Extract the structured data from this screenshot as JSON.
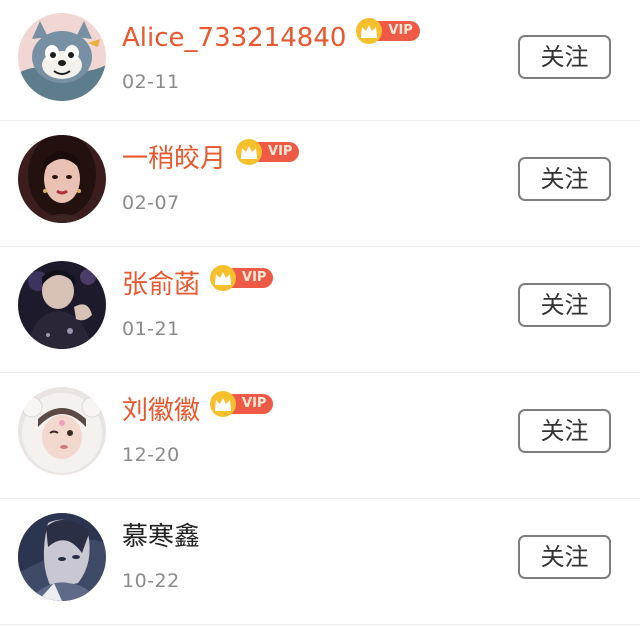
{
  "follow_list": {
    "items": [
      {
        "name": "Alice_733214840",
        "vip": true,
        "vip_label": "VIP",
        "date": "02-11",
        "follow_label": "关注",
        "avatar_icon": "cartoon-cat-avatar-icon"
      },
      {
        "name": "一稍皎月",
        "vip": true,
        "vip_label": "VIP",
        "date": "02-07",
        "follow_label": "关注",
        "avatar_icon": "woman-portrait-avatar-icon"
      },
      {
        "name": "张俞菡",
        "vip": true,
        "vip_label": "VIP",
        "date": "01-21",
        "follow_label": "关注",
        "avatar_icon": "man-stage-avatar-icon"
      },
      {
        "name": "刘徽徽",
        "vip": true,
        "vip_label": "VIP",
        "date": "12-20",
        "follow_label": "关注",
        "avatar_icon": "girl-hood-avatar-icon"
      },
      {
        "name": "慕寒鑫",
        "vip": false,
        "vip_label": "",
        "date": "10-22",
        "follow_label": "关注",
        "avatar_icon": "anime-character-avatar-icon"
      }
    ]
  },
  "colors": {
    "vip_name": "#e8572e",
    "normal_name": "#222222",
    "date": "#8b8b8b",
    "vip_badge": "#ee5a46",
    "vip_crown": "#f6c02c",
    "button_border": "#7e7e7e"
  }
}
